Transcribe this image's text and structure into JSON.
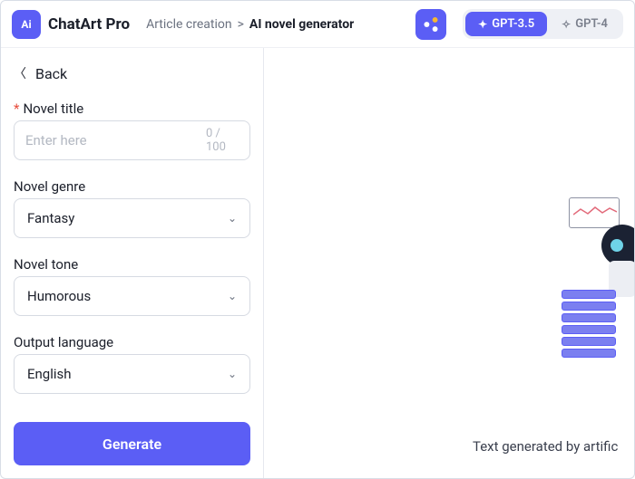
{
  "header": {
    "logo_badge": "Ai",
    "logo_text": "ChatArt Pro",
    "breadcrumb_parent": "Article creation",
    "breadcrumb_sep": ">",
    "breadcrumb_current": "AI novel generator",
    "models": [
      {
        "label": "GPT-3.5",
        "active": true
      },
      {
        "label": "GPT-4",
        "active": false
      }
    ]
  },
  "sidebar": {
    "back_label": "Back",
    "fields": {
      "title": {
        "label": "Novel title",
        "placeholder": "Enter here",
        "counter": "0 / 100",
        "required": true
      },
      "genre": {
        "label": "Novel genre",
        "value": "Fantasy"
      },
      "tone": {
        "label": "Novel tone",
        "value": "Humorous"
      },
      "language": {
        "label": "Output language",
        "value": "English"
      }
    },
    "generate_label": "Generate"
  },
  "main": {
    "caption": "Text generated by artific"
  }
}
